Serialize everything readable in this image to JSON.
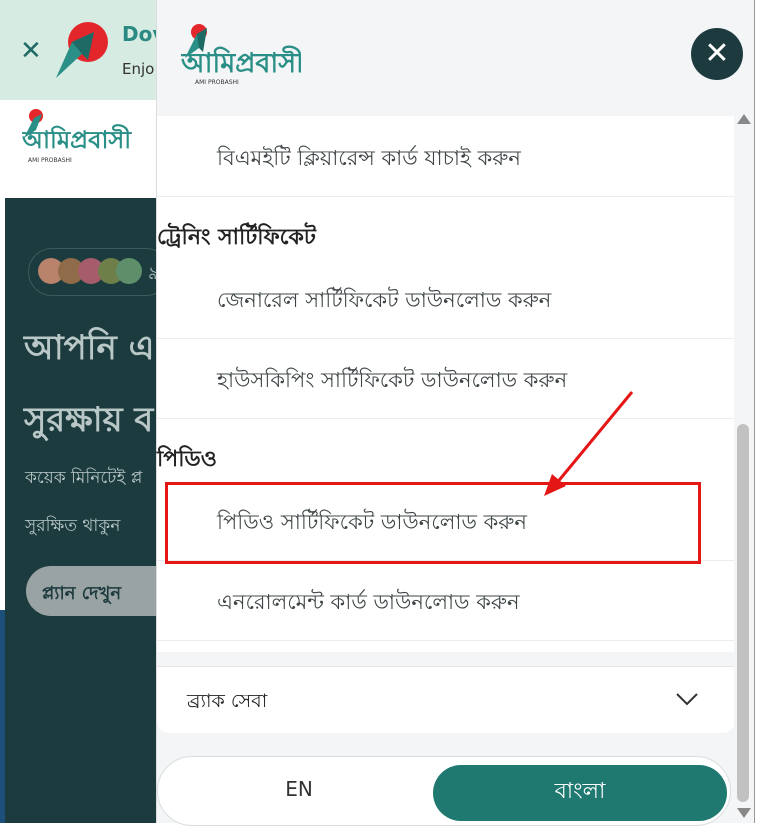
{
  "background": {
    "banner": {
      "title": "Dov",
      "subtitle": "Enjo"
    },
    "hero": {
      "count": "৯",
      "heading_line1": "আপনি এ",
      "heading_line2": "সুরক্ষায় ব",
      "para_line1": "কয়েক মিনিটেই প্ল",
      "para_line2": "সুরক্ষিত থাকুন",
      "plan_button": "প্ল্যান দেখুন"
    }
  },
  "drawer": {
    "logo": {
      "text": "আমিপ্রবাসী",
      "subtext": "AMI PROBASHI"
    },
    "items": [
      {
        "label": "বিএমইটি ক্লিয়ারেন্স কার্ড যাচাই করুন"
      },
      {
        "label": "জেনারেল সার্টিফিকেট ডাউনলোড করুন"
      },
      {
        "label": "হাউসকিপিং সার্টিফিকেট ডাউনলোড করুন"
      },
      {
        "label": "পিডিও সার্টিফিকেট ডাউনলোড করুন"
      },
      {
        "label": "এনরোলমেন্ট কার্ড ডাউনলোড করুন"
      }
    ],
    "sections": {
      "training": "ট্রেনিং সার্টিফিকেট",
      "pdo": "পিডিও"
    },
    "accordion": {
      "label": "ব্র্যাক সেবা"
    },
    "language": {
      "en": "EN",
      "bn": "বাংলা"
    }
  },
  "colors": {
    "brand_teal": "#1f7970",
    "close_dark": "#1d3b3f",
    "highlight_red": "#e41616"
  }
}
